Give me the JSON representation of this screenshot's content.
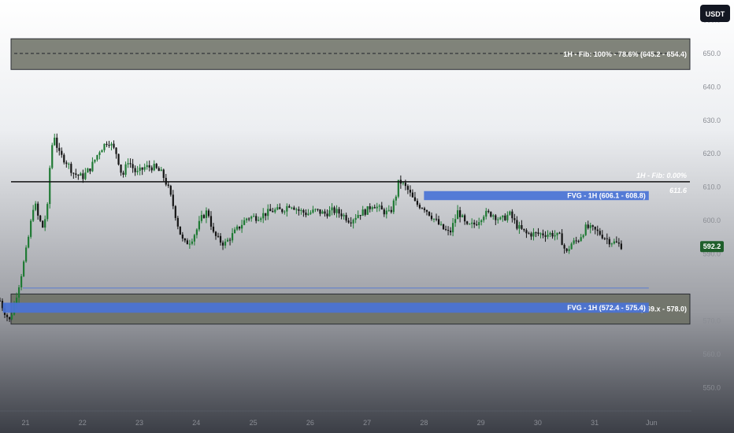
{
  "chart_data": {
    "type": "candlestick",
    "currency": "USDT",
    "last_price": "592.2",
    "y_range": [
      543,
      666
    ],
    "y_ticks": [
      {
        "v": 660,
        "label": "660.0"
      },
      {
        "v": 650,
        "label": "650.0"
      },
      {
        "v": 640,
        "label": "640.0"
      },
      {
        "v": 630,
        "label": "630.0"
      },
      {
        "v": 620,
        "label": "620.0"
      },
      {
        "v": 610,
        "label": "610.0"
      },
      {
        "v": 600,
        "label": "600.0"
      },
      {
        "v": 590,
        "label": "590.0"
      },
      {
        "v": 570,
        "label": "570.0"
      },
      {
        "v": 560,
        "label": "560.0"
      },
      {
        "v": 550,
        "label": "550.0"
      }
    ],
    "x_range": [
      20.55,
      32.7
    ],
    "x_ticks": [
      {
        "v": 21,
        "label": "21"
      },
      {
        "v": 22,
        "label": "22"
      },
      {
        "v": 23,
        "label": "23"
      },
      {
        "v": 24,
        "label": "24"
      },
      {
        "v": 25,
        "label": "25"
      },
      {
        "v": 26,
        "label": "26"
      },
      {
        "v": 27,
        "label": "27"
      },
      {
        "v": 28,
        "label": "28"
      },
      {
        "v": 29,
        "label": "29"
      },
      {
        "v": 30,
        "label": "30"
      },
      {
        "v": 31,
        "label": "31"
      },
      {
        "v": 32,
        "label": "Jun"
      }
    ],
    "price_path": [
      [
        20.55,
        576
      ],
      [
        20.65,
        572
      ],
      [
        20.72,
        570
      ],
      [
        20.8,
        575
      ],
      [
        20.9,
        582
      ],
      [
        21.0,
        590
      ],
      [
        21.08,
        598
      ],
      [
        21.15,
        606
      ],
      [
        21.22,
        601
      ],
      [
        21.3,
        598
      ],
      [
        21.38,
        603
      ],
      [
        21.44,
        620
      ],
      [
        21.5,
        626
      ],
      [
        21.58,
        620
      ],
      [
        21.7,
        618
      ],
      [
        21.85,
        614
      ],
      [
        22.0,
        613
      ],
      [
        22.15,
        616
      ],
      [
        22.3,
        621
      ],
      [
        22.45,
        624
      ],
      [
        22.6,
        620
      ],
      [
        22.7,
        613
      ],
      [
        22.8,
        618
      ],
      [
        22.95,
        614
      ],
      [
        23.1,
        616
      ],
      [
        23.25,
        616
      ],
      [
        23.4,
        614
      ],
      [
        23.5,
        610
      ],
      [
        23.6,
        604
      ],
      [
        23.7,
        597
      ],
      [
        23.78,
        593
      ],
      [
        23.9,
        594
      ],
      [
        24.0,
        597
      ],
      [
        24.1,
        601
      ],
      [
        24.2,
        603
      ],
      [
        24.3,
        596
      ],
      [
        24.4,
        594
      ],
      [
        24.5,
        593
      ],
      [
        24.6,
        595
      ],
      [
        24.75,
        598
      ],
      [
        24.9,
        601
      ],
      [
        25.05,
        601
      ],
      [
        25.2,
        602
      ],
      [
        25.35,
        603
      ],
      [
        25.5,
        603
      ],
      [
        25.65,
        605
      ],
      [
        25.8,
        603
      ],
      [
        25.95,
        602
      ],
      [
        26.1,
        603
      ],
      [
        26.25,
        602
      ],
      [
        26.4,
        603
      ],
      [
        26.55,
        602
      ],
      [
        26.7,
        600
      ],
      [
        26.85,
        602
      ],
      [
        27.0,
        603
      ],
      [
        27.1,
        605
      ],
      [
        27.25,
        603
      ],
      [
        27.4,
        602
      ],
      [
        27.5,
        607
      ],
      [
        27.56,
        612
      ],
      [
        27.62,
        611
      ],
      [
        27.72,
        609
      ],
      [
        27.85,
        605
      ],
      [
        28.0,
        604
      ],
      [
        28.15,
        601
      ],
      [
        28.3,
        598
      ],
      [
        28.45,
        596
      ],
      [
        28.6,
        603
      ],
      [
        28.75,
        598
      ],
      [
        28.9,
        599
      ],
      [
        29.05,
        602
      ],
      [
        29.2,
        602
      ],
      [
        29.35,
        600
      ],
      [
        29.5,
        602
      ],
      [
        29.65,
        598
      ],
      [
        29.8,
        596
      ],
      [
        29.95,
        596
      ],
      [
        30.1,
        596
      ],
      [
        30.25,
        596
      ],
      [
        30.4,
        595
      ],
      [
        30.5,
        590
      ],
      [
        30.58,
        593
      ],
      [
        30.7,
        594
      ],
      [
        30.85,
        598
      ],
      [
        31.0,
        597
      ],
      [
        31.1,
        596
      ],
      [
        31.25,
        594
      ],
      [
        31.4,
        593
      ],
      [
        31.5,
        592.2
      ]
    ],
    "zones": [
      {
        "name": "fib-zone-top",
        "y1": 645.2,
        "y2": 654.4,
        "dashed_y": 650,
        "label": "1H - Fib: 100% - 78.6% (645.2 - 654.4)"
      },
      {
        "name": "fib-zone-bottom",
        "y1": 569,
        "y2": 578.0,
        "label": "1H - Fib: 0% (569.x - 578.0)"
      }
    ],
    "fvgs": [
      {
        "name": "fvg-upper",
        "x1": 28.0,
        "x2": 31.95,
        "y1": 606.1,
        "y2": 608.8,
        "label": "FVG - 1H (606.1 - 608.8)"
      },
      {
        "name": "fvg-lower",
        "x1": 20.6,
        "x2": 31.95,
        "y1": 572.4,
        "y2": 575.4,
        "label": "FVG - 1H (572.4 - 575.4)"
      }
    ],
    "levels": [
      {
        "name": "fib-zero-line",
        "y": 611.6,
        "label": "1H - Fib: 0.00%",
        "value_label": "611.6"
      },
      {
        "name": "thin-support-line",
        "y": 579.8,
        "x1": 20.95,
        "x2": 31.95
      }
    ]
  }
}
